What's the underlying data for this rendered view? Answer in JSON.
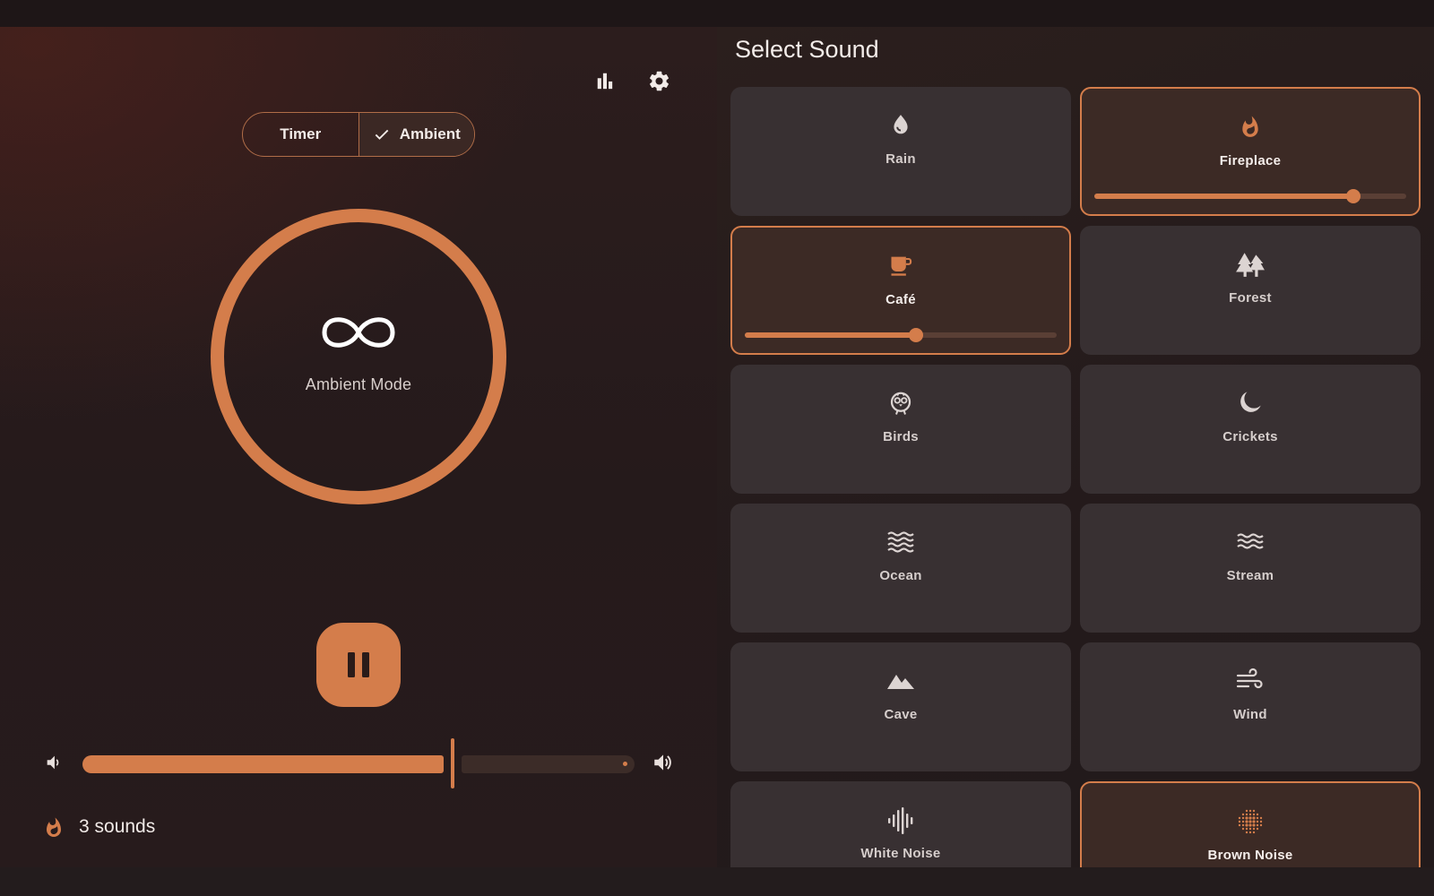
{
  "header": {
    "stats_icon": "bar-chart-icon",
    "settings_icon": "gear-icon"
  },
  "mode_toggle": {
    "options": [
      {
        "label": "Timer",
        "selected": false
      },
      {
        "label": "Ambient",
        "selected": true
      }
    ]
  },
  "ring": {
    "symbol_icon": "infinity-icon",
    "label": "Ambient Mode"
  },
  "playback": {
    "state": "playing",
    "button_icon": "pause-icon"
  },
  "volume": {
    "level": 0.67
  },
  "footer": {
    "icon": "fire-icon",
    "sound_count": "3 sounds"
  },
  "panel": {
    "title": "Select Sound",
    "sounds": [
      {
        "label": "Rain",
        "icon": "water-drop-icon",
        "active": false
      },
      {
        "label": "Fireplace",
        "icon": "fire-icon",
        "active": true,
        "volume": 0.83
      },
      {
        "label": "Café",
        "icon": "coffee-cup-icon",
        "active": true,
        "volume": 0.55
      },
      {
        "label": "Forest",
        "icon": "forest-icon",
        "active": false
      },
      {
        "label": "Birds",
        "icon": "bird-icon",
        "active": false
      },
      {
        "label": "Crickets",
        "icon": "moon-icon",
        "active": false
      },
      {
        "label": "Ocean",
        "icon": "waves-icon",
        "active": false
      },
      {
        "label": "Stream",
        "icon": "stream-icon",
        "active": false
      },
      {
        "label": "Cave",
        "icon": "mountain-icon",
        "active": false
      },
      {
        "label": "Wind",
        "icon": "wind-icon",
        "active": false
      },
      {
        "label": "White Noise",
        "icon": "waveform-icon",
        "active": false
      },
      {
        "label": "Brown Noise",
        "icon": "noise-grain-icon",
        "active": true
      }
    ]
  },
  "colors": {
    "accent": "#d47d4b",
    "card_bg": "#383032",
    "card_active_bg": "#3c2a25",
    "background": "#251a1b"
  }
}
